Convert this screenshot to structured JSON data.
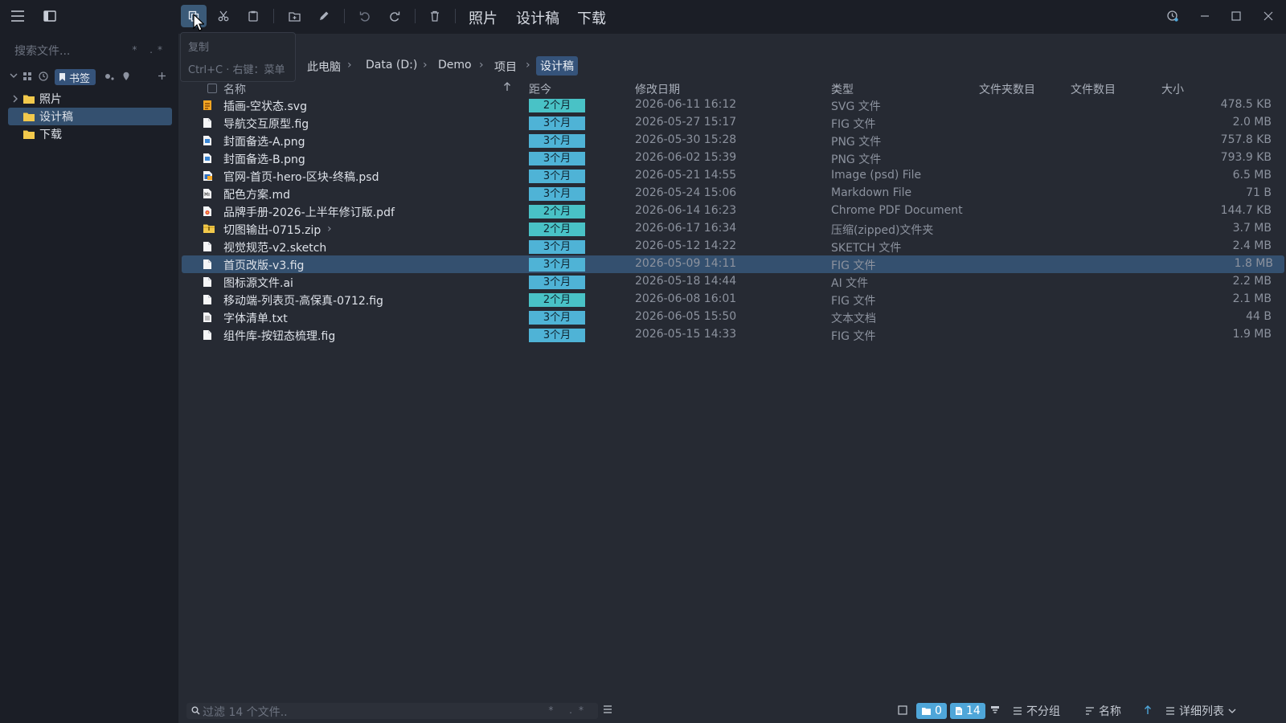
{
  "toolbar": {
    "quick_links": [
      "照片",
      "设计稿",
      "下载"
    ]
  },
  "tooltip": {
    "title": "复制",
    "desc": "Ctrl+C · 右键：菜单"
  },
  "sidebar": {
    "search_placeholder": "搜索文件...",
    "wildcards": "* .*",
    "bookmarks_tab": "书签",
    "tree": [
      {
        "label": "照片",
        "expandable": true
      },
      {
        "label": "设计稿",
        "expandable": false
      },
      {
        "label": "下载",
        "expandable": false
      }
    ]
  },
  "breadcrumb": [
    "此电脑",
    "Data (D:)",
    "Demo",
    "项目",
    "设计稿"
  ],
  "columns": {
    "name": "名称",
    "age": "距今",
    "modified": "修改日期",
    "type": "类型",
    "folders": "文件夹数目",
    "files": "文件数目",
    "size": "大小"
  },
  "files": [
    {
      "name": "插画-空状态.svg",
      "icon": "svg-file-icon",
      "age": "2个月",
      "recent": true,
      "modified": "2026-06-11 16:12",
      "type": "SVG 文件",
      "size": "478.5 KB"
    },
    {
      "name": "导航交互原型.fig",
      "icon": "document-icon",
      "age": "3个月",
      "recent": false,
      "modified": "2026-05-27 15:17",
      "type": "FIG 文件",
      "size": "2.0 MB"
    },
    {
      "name": "封面备选-A.png",
      "icon": "image-file-icon",
      "age": "3个月",
      "recent": false,
      "modified": "2026-05-30 15:28",
      "type": "PNG 文件",
      "size": "757.8 KB"
    },
    {
      "name": "封面备选-B.png",
      "icon": "image-file-icon",
      "age": "3个月",
      "recent": false,
      "modified": "2026-06-02 15:39",
      "type": "PNG 文件",
      "size": "793.9 KB"
    },
    {
      "name": "官网-首页-hero-区块-终稿.psd",
      "icon": "psd-file-icon",
      "age": "3个月",
      "recent": false,
      "modified": "2026-05-21 14:55",
      "type": "Image (psd) File",
      "size": "6.5 MB"
    },
    {
      "name": "配色方案.md",
      "icon": "markdown-file-icon",
      "age": "3个月",
      "recent": false,
      "modified": "2026-05-24 15:06",
      "type": "Markdown File",
      "size": "71 B"
    },
    {
      "name": "品牌手册-2026-上半年修订版.pdf",
      "icon": "pdf-file-icon",
      "age": "2个月",
      "recent": true,
      "modified": "2026-06-14 16:23",
      "type": "Chrome PDF Document",
      "size": "144.7 KB"
    },
    {
      "name": "切图输出-0715.zip",
      "icon": "zip-folder-icon",
      "age": "2个月",
      "recent": true,
      "modified": "2026-06-17 16:34",
      "type": "压缩(zipped)文件夹",
      "size": "3.7 MB",
      "chevron": true
    },
    {
      "name": "视觉规范-v2.sketch",
      "icon": "document-icon",
      "age": "3个月",
      "recent": false,
      "modified": "2026-05-12 14:22",
      "type": "SKETCH 文件",
      "size": "2.4 MB"
    },
    {
      "name": "首页改版-v3.fig",
      "icon": "document-icon",
      "age": "3个月",
      "recent": false,
      "modified": "2026-05-09 14:11",
      "type": "FIG 文件",
      "size": "1.8 MB",
      "selected": true
    },
    {
      "name": "图标源文件.ai",
      "icon": "document-icon",
      "age": "3个月",
      "recent": false,
      "modified": "2026-05-18 14:44",
      "type": "AI 文件",
      "size": "2.2 MB"
    },
    {
      "name": "移动端-列表页-高保真-0712.fig",
      "icon": "document-icon",
      "age": "2个月",
      "recent": true,
      "modified": "2026-06-08 16:01",
      "type": "FIG 文件",
      "size": "2.1 MB"
    },
    {
      "name": "字体清单.txt",
      "icon": "text-file-icon",
      "age": "3个月",
      "recent": false,
      "modified": "2026-06-05 15:50",
      "type": "文本文档",
      "size": "44 B"
    },
    {
      "name": "组件库-按钮态梳理.fig",
      "icon": "document-icon",
      "age": "3个月",
      "recent": false,
      "modified": "2026-05-15 14:33",
      "type": "FIG 文件",
      "size": "1.9 MB"
    }
  ],
  "statusbar": {
    "filter_placeholder": "过滤 14 个文件..",
    "wildcards": "* .*",
    "folder_count": "0",
    "file_count": "14",
    "group_label": "不分组",
    "sort_label": "名称",
    "view_label": "详细列表"
  },
  "colors": {
    "accent": "#35537a",
    "age_badge": "#4fb3d6",
    "age_badge_recent": "#49c2c6",
    "count_badge": "#4fa6d9"
  }
}
